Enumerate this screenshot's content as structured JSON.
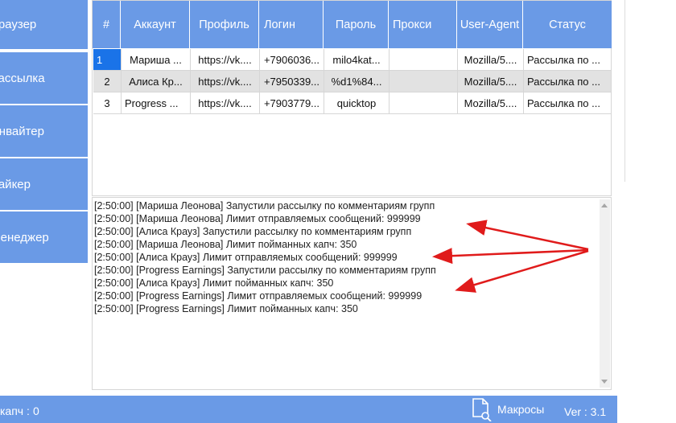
{
  "sidebar": {
    "items": [
      {
        "label": "Браузер"
      },
      {
        "label": "Рассылка"
      },
      {
        "label": "Инвайтер"
      },
      {
        "label": "Лайкер"
      },
      {
        "label": "Менеджер"
      }
    ]
  },
  "table": {
    "headers": [
      "#",
      "Аккаунт",
      "Профиль",
      "Логин",
      "Пароль",
      "Прокси",
      "User-Agent",
      "Статус"
    ],
    "rows": [
      {
        "num": "1",
        "account": "Мариша ...",
        "profile": "https://vk....",
        "login": "+7906036...",
        "password": "milo4kat...",
        "proxy": "",
        "ua": "Mozilla/5....",
        "status": "Рассылка по ..."
      },
      {
        "num": "2",
        "account": "Алиса Кр...",
        "profile": "https://vk....",
        "login": "+7950339...",
        "password": "%d1%84...",
        "proxy": "",
        "ua": "Mozilla/5....",
        "status": "Рассылка по ..."
      },
      {
        "num": "3",
        "account": "Progress ...",
        "profile": "https://vk....",
        "login": "+7903779...",
        "password": "quicktop",
        "proxy": "",
        "ua": "Mozilla/5....",
        "status": "Рассылка по ..."
      }
    ]
  },
  "log": {
    "lines": [
      "[2:50:00]  [Мариша Леонова] Запустили рассылку по комментариям групп",
      "[2:50:00]  [Мариша Леонова] Лимит отправляемых сообщений: 999999",
      "[2:50:00]  [Алиса Крауз] Запустили рассылку по комментариям групп",
      "[2:50:00]  [Мариша Леонова] Лимит пойманных капч: 350",
      "[2:50:00]  [Алиса Крауз] Лимит отправляемых сообщений: 999999",
      "[2:50:00]  [Progress Earnings] Запустили рассылку по комментариям групп",
      "[2:50:00]  [Алиса Крауз] Лимит пойманных капч: 350",
      "[2:50:00]  [Progress Earnings] Лимит отправляемых сообщений: 999999",
      "[2:50:00]  [Progress Earnings] Лимит пойманных капч: 350"
    ]
  },
  "status": {
    "captcha_label": "капч :",
    "captcha_value": "0",
    "macros_label": "Макросы",
    "macros_icon": "document-search-icon",
    "version": "Ver : 3.1"
  },
  "colors": {
    "accent": "#6a9ae6",
    "selection": "#1a73e8",
    "annotation_arrow": "#e01b1b"
  }
}
